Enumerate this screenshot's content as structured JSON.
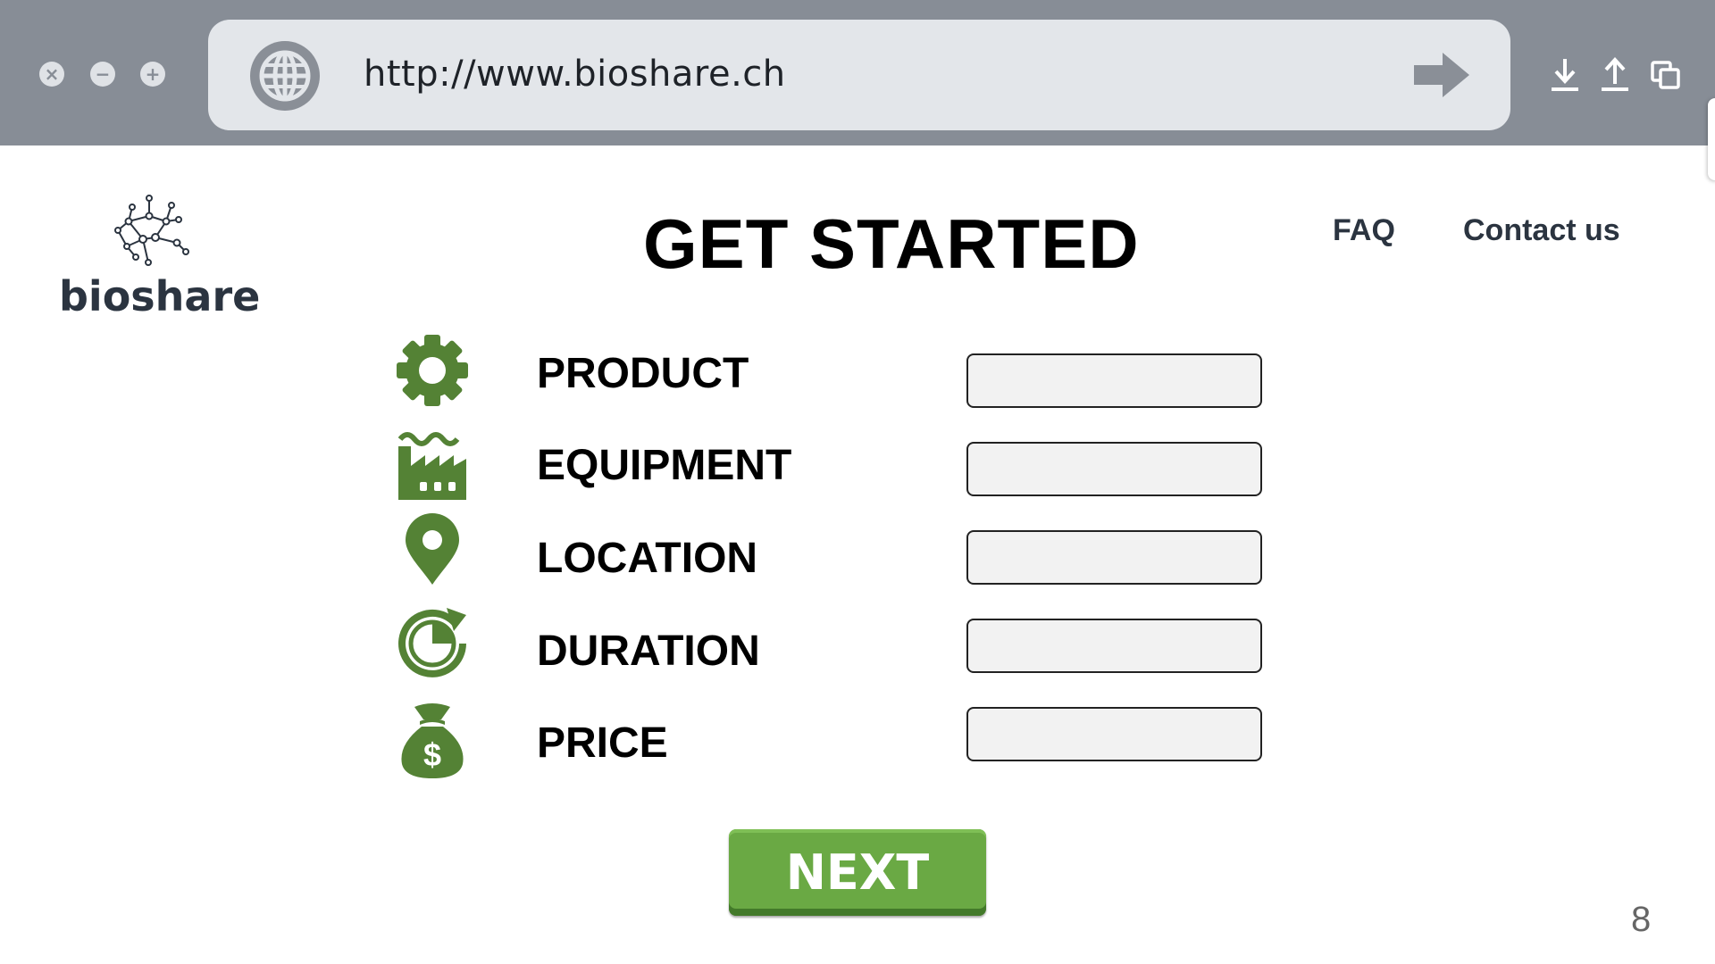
{
  "browser": {
    "url": "http://www.bioshare.ch",
    "window_buttons": {
      "close": "×",
      "minimize": "−",
      "maximize": "+"
    },
    "icons": [
      "globe-icon",
      "go-arrow-icon",
      "download-icon",
      "upload-icon",
      "copy-window-icon"
    ]
  },
  "brand": {
    "name": "bioshare",
    "logo_icon": "molecule-network-icon"
  },
  "page": {
    "title": "GET STARTED"
  },
  "nav": {
    "faq": "FAQ",
    "contact": "Contact us"
  },
  "form": {
    "fields": [
      {
        "label": "PRODUCT",
        "icon": "gear-icon",
        "value": ""
      },
      {
        "label": "EQUIPMENT",
        "icon": "factory-icon",
        "value": ""
      },
      {
        "label": "LOCATION",
        "icon": "location-pin-icon",
        "value": ""
      },
      {
        "label": "DURATION",
        "icon": "clock-refresh-icon",
        "value": ""
      },
      {
        "label": "PRICE",
        "icon": "money-bag-icon",
        "value": ""
      }
    ],
    "next_label": "NEXT",
    "icon_color": "#548235",
    "button_color": "#6aa944"
  },
  "page_number": "8"
}
